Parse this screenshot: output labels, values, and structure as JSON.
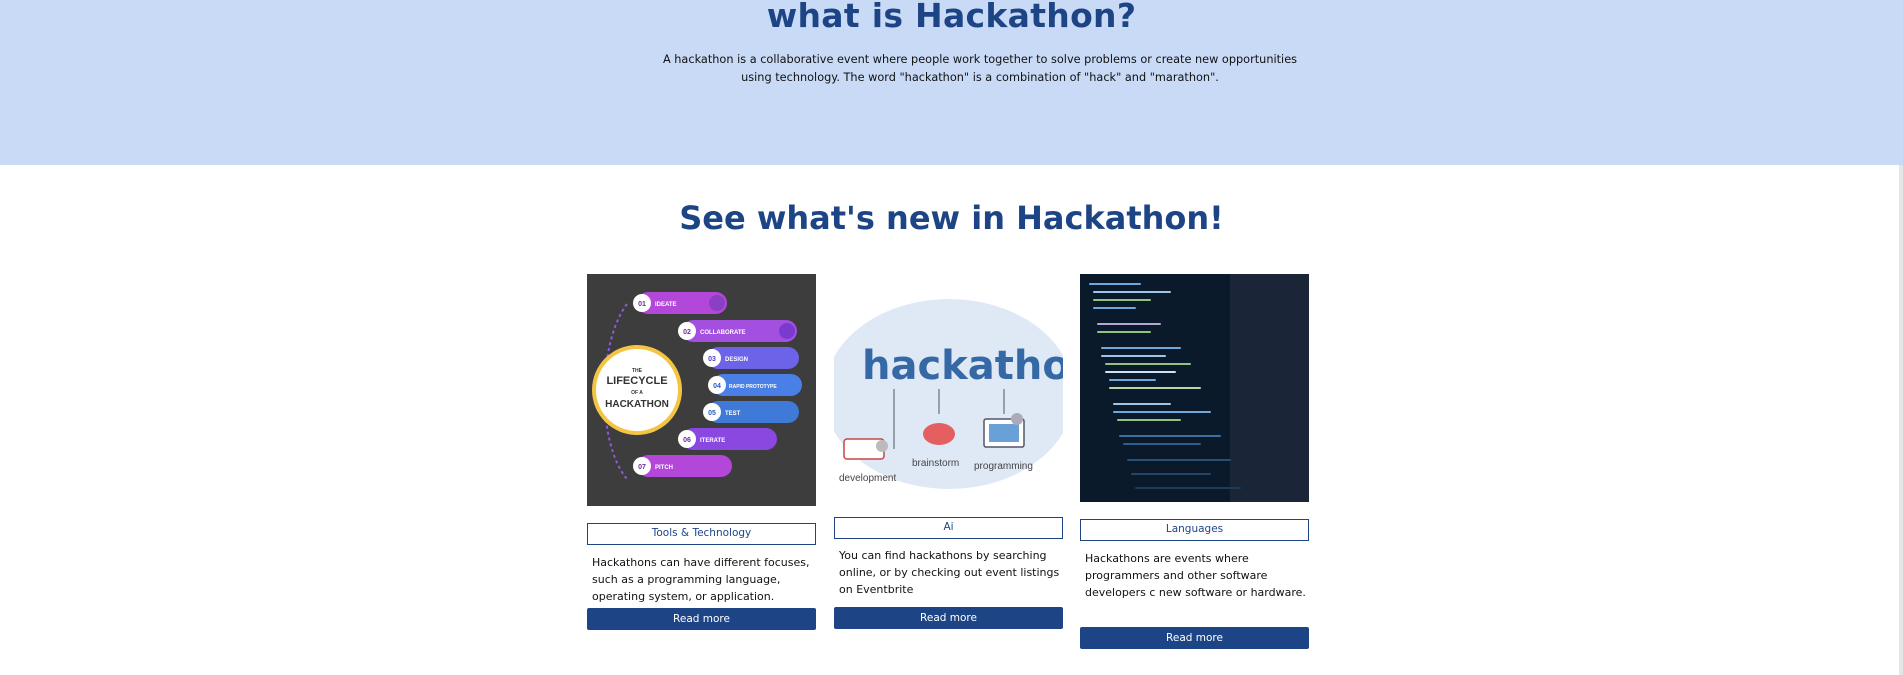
{
  "hero": {
    "title": "what is Hackathon?",
    "description": "A hackathon is a collaborative event where people work together to solve problems or create new opportunities using technology. The word \"hackathon\" is a combination of \"hack\" and \"marathon\"."
  },
  "news": {
    "title": "See what's new in Hackathon!",
    "cards": [
      {
        "tag": "Tools & Technology",
        "text": "Hackathons can have different focuses, such as a programming language, operating system, or application.",
        "button": "Read more",
        "image": {
          "title_lines": [
            "THE",
            "LIFECYCLE",
            "OF A",
            "HACKATHON"
          ],
          "steps": [
            {
              "num": "01",
              "label": "IDEATE"
            },
            {
              "num": "02",
              "label": "COLLABORATE"
            },
            {
              "num": "03",
              "label": "DESIGN"
            },
            {
              "num": "04",
              "label": "RAPID PROTOTYPE"
            },
            {
              "num": "05",
              "label": "TEST"
            },
            {
              "num": "06",
              "label": "ITERATE"
            },
            {
              "num": "07",
              "label": "PITCH"
            }
          ]
        }
      },
      {
        "tag": "Ai",
        "text": "You can find hackathons by searching online, or by checking out event listings on Eventbrite",
        "button": "Read more",
        "image": {
          "word": "hackathon",
          "labels": [
            "development",
            "brainstorm",
            "programming"
          ]
        }
      },
      {
        "tag": "Languages",
        "text": "Hackathons are events where programmers and other software developers c new software or hardware.",
        "button": "Read more"
      }
    ]
  }
}
